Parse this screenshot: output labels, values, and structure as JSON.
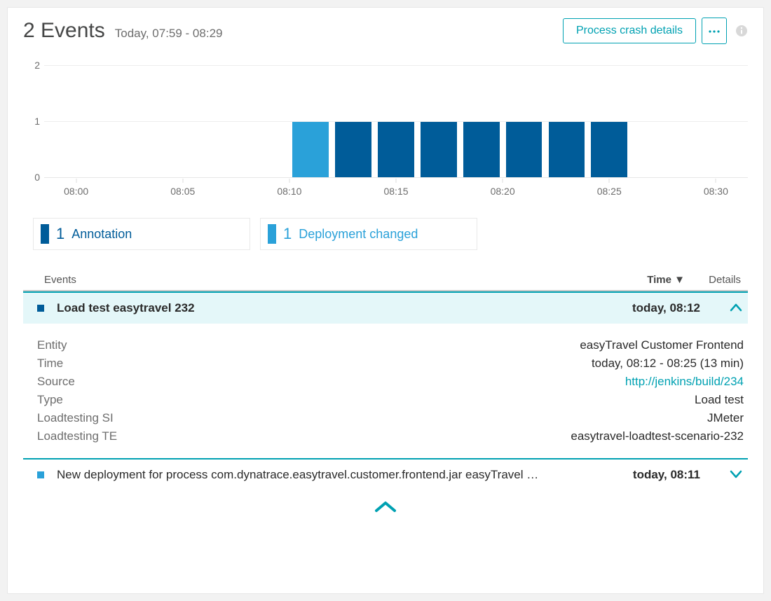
{
  "header": {
    "title": "2 Events",
    "time_range": "Today, 07:59 - 08:29",
    "primary_button": "Process crash details",
    "more_label": "..."
  },
  "colors": {
    "annotation": "#005c99",
    "deployment": "#2aa1d9"
  },
  "chart_data": {
    "type": "bar",
    "title": "",
    "xlabel": "",
    "ylabel": "",
    "ylim": [
      0,
      2
    ],
    "y_ticks": [
      0,
      1,
      2
    ],
    "x_ticks": [
      "08:00",
      "08:05",
      "08:10",
      "08:15",
      "08:20",
      "08:25",
      "08:30"
    ],
    "x_range_minutes": [
      -1.5,
      31.5
    ],
    "bar_width_min": 1.7,
    "series": [
      {
        "name": "Deployment changed",
        "color_key": "deployment",
        "points": [
          {
            "minute": 11,
            "value": 1
          }
        ]
      },
      {
        "name": "Annotation",
        "color_key": "annotation",
        "points": [
          {
            "minute": 13,
            "value": 1
          },
          {
            "minute": 15,
            "value": 1
          },
          {
            "minute": 17,
            "value": 1
          },
          {
            "minute": 19,
            "value": 1
          },
          {
            "minute": 21,
            "value": 1
          },
          {
            "minute": 23,
            "value": 1
          },
          {
            "minute": 25,
            "value": 1
          }
        ]
      }
    ]
  },
  "legend": {
    "items": [
      {
        "count": "1",
        "label": "Annotation",
        "color_key": "annotation"
      },
      {
        "count": "1",
        "label": "Deployment changed",
        "color_key": "deployment"
      }
    ]
  },
  "table": {
    "headers": {
      "events": "Events",
      "time": "Time ▼",
      "details": "Details"
    }
  },
  "events": [
    {
      "color_key": "annotation",
      "name": "Load test easytravel 232",
      "time": "today, 08:12",
      "expanded": true,
      "details": [
        {
          "k": "Entity",
          "v": "easyTravel Customer Frontend",
          "link": false
        },
        {
          "k": "Time",
          "v": "today, 08:12 - 08:25 (13 min)",
          "link": false
        },
        {
          "k": "Source",
          "v": "http://jenkins/build/234",
          "link": true
        },
        {
          "k": "Type",
          "v": "Load test",
          "link": false
        },
        {
          "k": "Loadtesting SI",
          "v": "JMeter",
          "link": false
        },
        {
          "k": "Loadtesting TE",
          "v": "easytravel-loadtest-scenario-232",
          "link": false
        }
      ]
    },
    {
      "color_key": "deployment",
      "name": "New deployment for process com.dynatrace.easytravel.customer.frontend.jar easyTravel …",
      "time": "today, 08:11",
      "expanded": false
    }
  ]
}
